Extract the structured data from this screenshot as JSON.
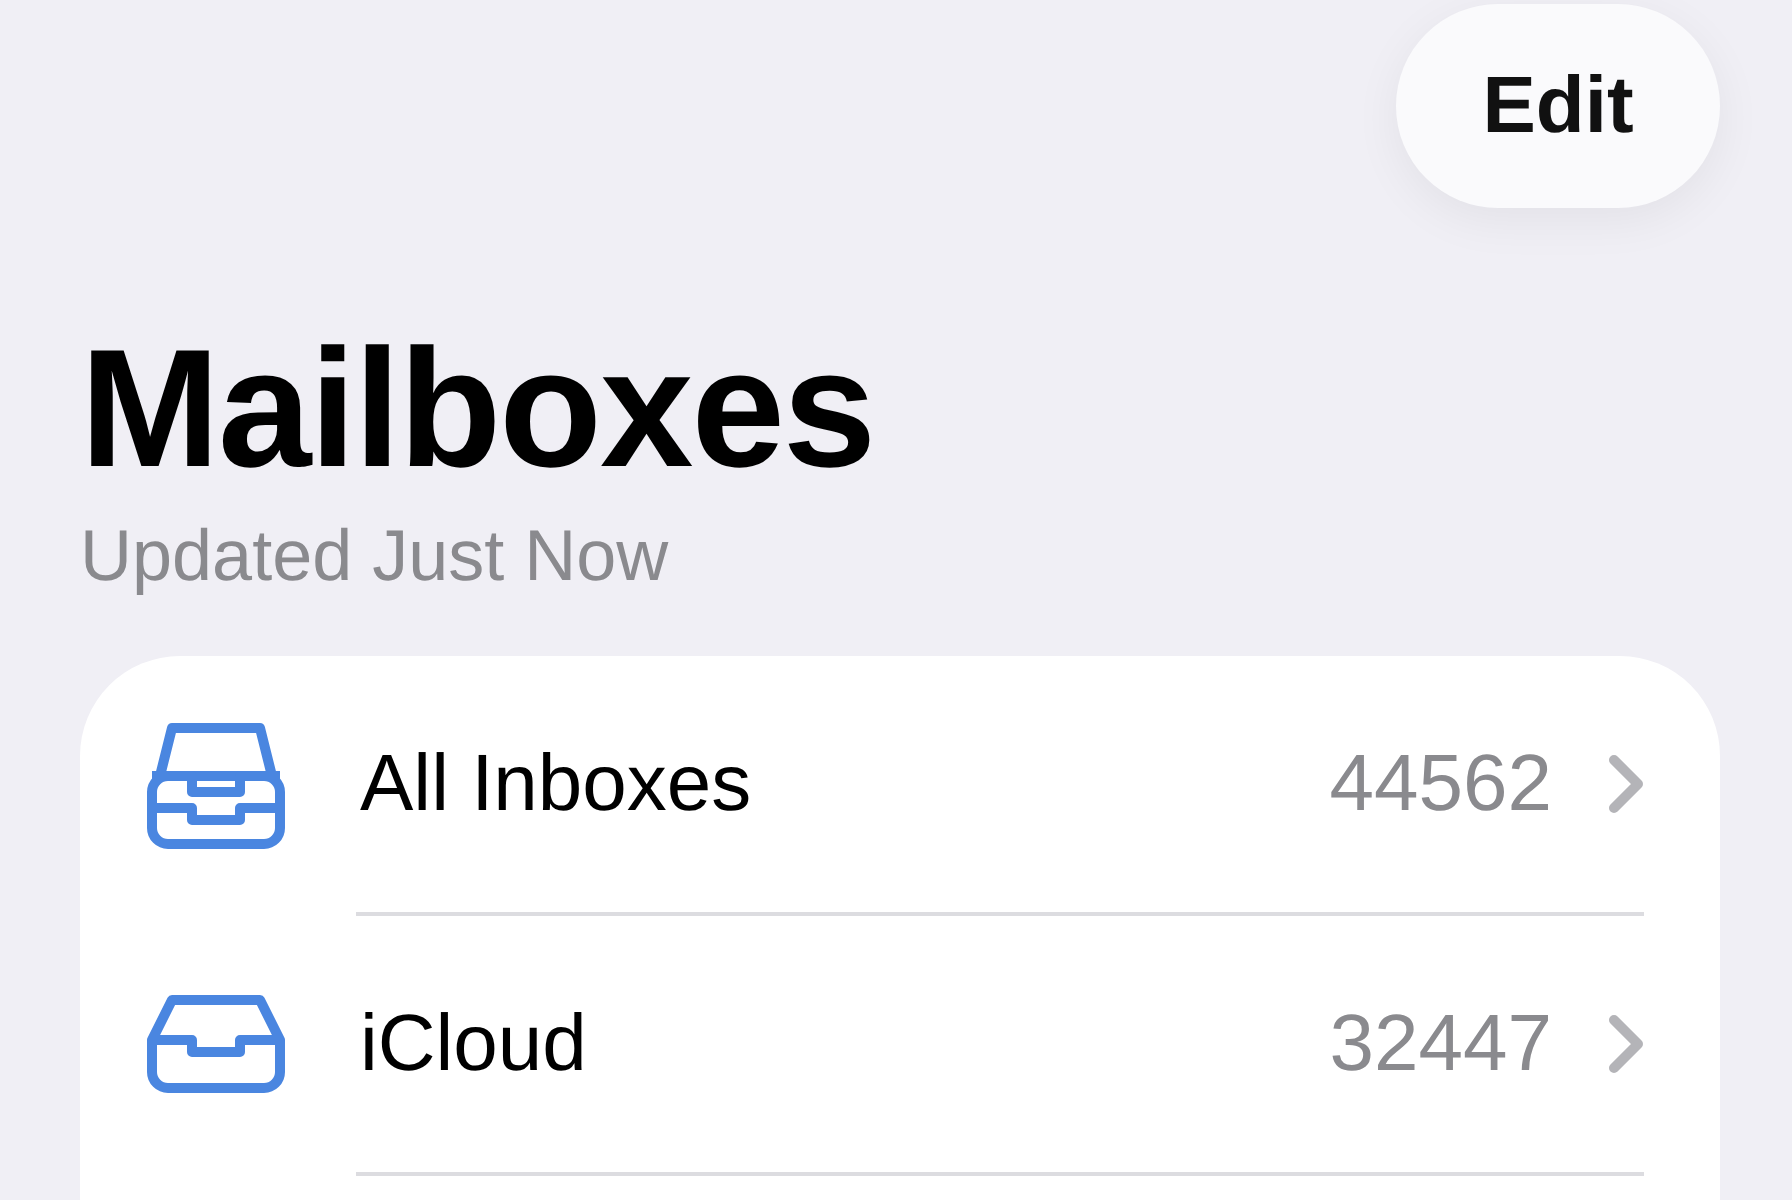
{
  "edit_button": {
    "label": "Edit"
  },
  "title": "Mailboxes",
  "subtitle": "Updated Just Now",
  "mailboxes": [
    {
      "kind": "stacked",
      "name": "All Inboxes",
      "count": "44562"
    },
    {
      "kind": "single",
      "name": "iCloud",
      "count": "32447"
    }
  ]
}
